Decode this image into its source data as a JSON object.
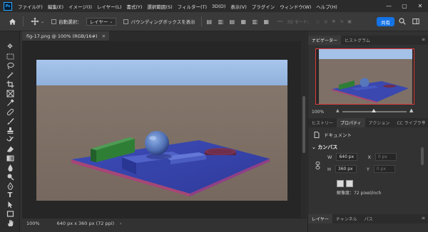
{
  "app": {
    "logo": "Ps",
    "menu": [
      "ファイル(F)",
      "編集(E)",
      "イメージ(I)",
      "レイヤー(L)",
      "書式(Y)",
      "選択範囲(S)",
      "フィルター(T)",
      "3D(D)",
      "表示(V)",
      "プラグイン",
      "ウィンドウ(W)",
      "ヘルプ(H)"
    ],
    "window_controls": {
      "minimize": "—",
      "maximize": "▢",
      "close": "✕"
    }
  },
  "options_bar": {
    "auto_select_label": "自動選択：",
    "auto_select_target": "レイヤー",
    "bounding_box_label": "バウンディングボックスを表示",
    "more": "···",
    "mode_3d_label": "3D モード：",
    "share_label": "共有"
  },
  "document": {
    "tab_title": "fig-17.png @ 100% (RGB/16#)",
    "tab_close": "✕",
    "zoom": "100%",
    "info": "640 px x 360 px (72 ppi)",
    "info_arrow": "›"
  },
  "panels": {
    "top_tabs": [
      "ナビゲーター",
      "ヒストグラム"
    ],
    "navigator_zoom": "100%",
    "mid_tabs": [
      "ヒストリー",
      "プロパティ",
      "アクション",
      "CC ライブラリ"
    ],
    "properties": {
      "doc_label": "ドキュメント",
      "section": "カンバス",
      "width_label": "W",
      "width_value": "640 px",
      "height_label": "H",
      "height_value": "360 px",
      "x_label": "X",
      "x_value": "0 px",
      "y_label": "Y",
      "y_value": "0 px",
      "resolution": "解像度：72 pixel/inch"
    },
    "bottom_tabs": [
      "レイヤー",
      "チャンネル",
      "パス"
    ]
  },
  "colors": {
    "accent": "#1473e6",
    "sky": "#9ab8de",
    "floor": "#7d6e63",
    "platform": "#3f4bb5",
    "platform_edge": "#a4466a",
    "green_box": "#2f7a35",
    "sphere": "#5b7fbf"
  }
}
